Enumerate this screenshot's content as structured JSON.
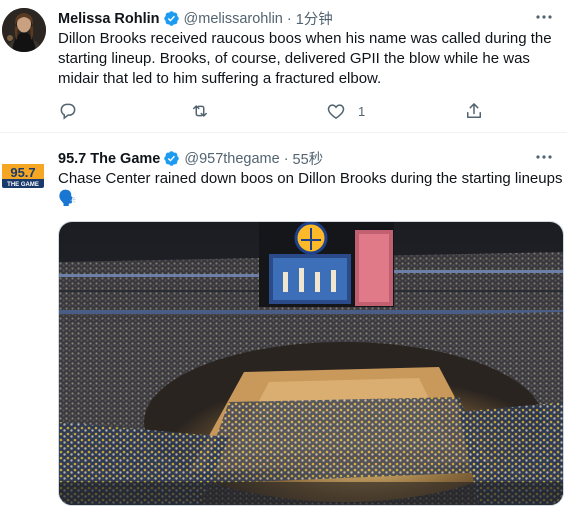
{
  "tweets": [
    {
      "author": "Melissa Rohlin",
      "handle": "@melissarohlin",
      "separator": "·",
      "time": "1分钟",
      "verified": true,
      "text_lines": [
        "Dillon Brooks received raucous boos when his name was called during the",
        "starting lineup. Brooks, of course, delivered GPII the blow while he was",
        "midair that led to him suffering a fractured elbow."
      ],
      "actions": {
        "reply_icon": "reply-icon",
        "retweet_icon": "retweet-icon",
        "like_icon": "heart-icon",
        "like_count": "1",
        "share_icon": "share-icon"
      }
    },
    {
      "author": "95.7 The Game",
      "handle": "@957thegame",
      "separator": "·",
      "time": "55秒",
      "verified": true,
      "avatar_text_top": "95.7",
      "avatar_text_bottom": "THE GAME",
      "text_lines": [
        "Chase Center rained down boos on Dillon Brooks during the starting lineups"
      ],
      "emoji": "🗣️",
      "media": {
        "type": "photo",
        "scoreboard_icon": "warriors-logo"
      }
    }
  ],
  "colors": {
    "verified_blue": "#1d9bf0",
    "text_primary": "#0f1419",
    "text_secondary": "#536471",
    "border": "#eff3f4",
    "brand_orange": "#f5a623"
  }
}
